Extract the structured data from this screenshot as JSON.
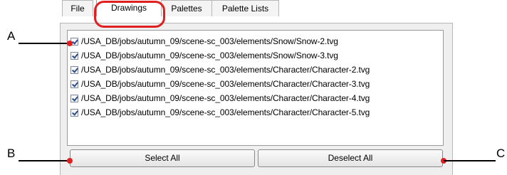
{
  "tabs": [
    {
      "label": "File"
    },
    {
      "label": "Drawings"
    },
    {
      "label": "Palettes"
    },
    {
      "label": "Palette Lists"
    }
  ],
  "active_tab": "Drawings",
  "drawings": [
    {
      "path": "/USA_DB/jobs/autumn_09/scene-sc_003/elements/Snow/Snow-2.tvg",
      "checked": true
    },
    {
      "path": "/USA_DB/jobs/autumn_09/scene-sc_003/elements/Snow/Snow-3.tvg",
      "checked": true
    },
    {
      "path": "/USA_DB/jobs/autumn_09/scene-sc_003/elements/Character/Character-2.tvg",
      "checked": true
    },
    {
      "path": "/USA_DB/jobs/autumn_09/scene-sc_003/elements/Character/Character-3.tvg",
      "checked": true
    },
    {
      "path": "/USA_DB/jobs/autumn_09/scene-sc_003/elements/Character/Character-4.tvg",
      "checked": true
    },
    {
      "path": "/USA_DB/jobs/autumn_09/scene-sc_003/elements/Character/Character-5.tvg",
      "checked": true
    }
  ],
  "buttons": {
    "select_all": "Select All",
    "deselect_all": "Deselect All"
  },
  "callouts": {
    "a": "A",
    "b": "B",
    "c": "C"
  },
  "colors": {
    "highlight": "#e02020"
  }
}
